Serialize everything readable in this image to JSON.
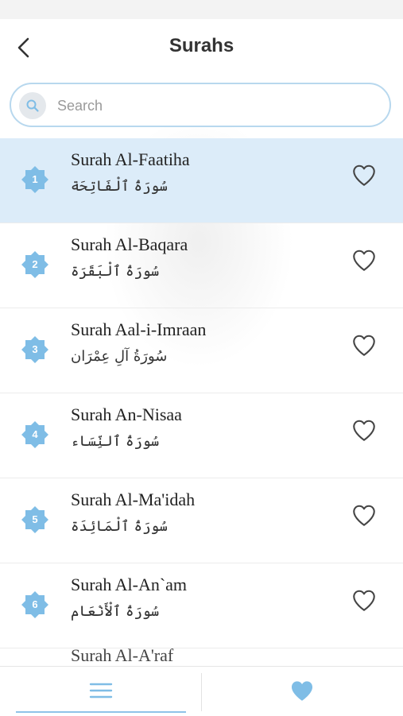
{
  "header": {
    "title": "Surahs"
  },
  "search": {
    "placeholder": "Search"
  },
  "surahs": [
    {
      "number": "1",
      "name_en": "Surah Al-Faatiha",
      "name_ar": "سُورَةُ ٱلْفَاتِحَة",
      "selected": true
    },
    {
      "number": "2",
      "name_en": "Surah Al-Baqara",
      "name_ar": "سُورَةُ ٱلْبَقَرَة"
    },
    {
      "number": "3",
      "name_en": "Surah Aal-i-Imraan",
      "name_ar": "سُورَةُ آلِ عِمْرَان"
    },
    {
      "number": "4",
      "name_en": "Surah An-Nisaa",
      "name_ar": "سُورَةُ ٱلنِّسَاء"
    },
    {
      "number": "5",
      "name_en": "Surah Al-Ma'idah",
      "name_ar": "سُورَةُ ٱلْمَائِدَة"
    },
    {
      "number": "6",
      "name_en": "Surah Al-An`am",
      "name_ar": "سُورَةُ ٱلْأَنْعَام"
    }
  ],
  "partial_row": {
    "name_en": "Surah Al-A'raf"
  },
  "colors": {
    "accent": "#7fbde6",
    "selected_row": "#dcecf9",
    "heart": "#7fbde6"
  },
  "icons": {
    "back": "chevron-left-icon",
    "search": "search-icon",
    "number_badge": "eight-point-star-icon",
    "favorite": "heart-outline-icon",
    "tab_list": "menu-icon",
    "tab_favorites": "heart-icon"
  }
}
